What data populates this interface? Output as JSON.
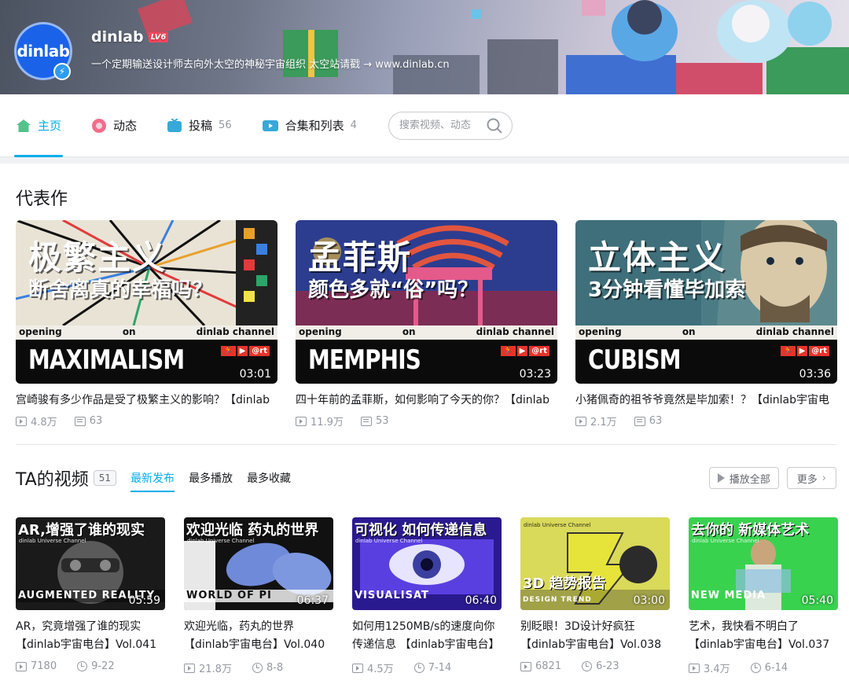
{
  "profile": {
    "avatar_text": "dinlab",
    "name": "dinlab",
    "level": "LV6",
    "signature": "一个定期输送设计师去向外太空的神秘宇宙组织 太空站请戳 → www.dinlab.cn"
  },
  "nav": {
    "tabs": [
      {
        "label": "主页",
        "count": ""
      },
      {
        "label": "动态",
        "count": ""
      },
      {
        "label": "投稿",
        "count": "56"
      },
      {
        "label": "合集和列表",
        "count": "4"
      }
    ],
    "search_placeholder": "搜索视频、动态"
  },
  "representative": {
    "title": "代表作",
    "items": [
      {
        "headline": "极繁主义",
        "subline": "断舍离真的幸福吗？",
        "strip_left": "opening",
        "strip_mid": "on",
        "strip_right": "dinlab channel",
        "word": "MAXIMALISM",
        "brand": "@rt",
        "duration": "03:01",
        "caption": "宫崎骏有多少作品是受了极繁主义的影响？【dinlab",
        "views": "4.8万",
        "danmaku": "63"
      },
      {
        "headline": "孟菲斯",
        "subline": "颜色多就“俗”吗？",
        "strip_left": "opening",
        "strip_mid": "on",
        "strip_right": "dinlab channel",
        "word": "MEMPHIS",
        "brand": "@rt",
        "duration": "03:23",
        "caption": "四十年前的孟菲斯，如何影响了今天的你？【dinlab",
        "views": "11.9万",
        "danmaku": "53"
      },
      {
        "headline": "立体主义",
        "subline": "3分钟看懂毕加索",
        "strip_left": "opening",
        "strip_mid": "on",
        "strip_right": "dinlab channel",
        "word": "CUBISM",
        "brand": "@rt",
        "duration": "03:36",
        "caption": "小猪佩奇的祖爷爷竟然是毕加索！？【dinlab宇宙电",
        "views": "2.1万",
        "danmaku": "63"
      }
    ]
  },
  "videos": {
    "title": "TA的视频",
    "count": "51",
    "tabs": [
      "最新发布",
      "最多播放",
      "最多收藏"
    ],
    "play_all": "播放全部",
    "more": "更多",
    "items": [
      {
        "thumb_title": "AR,增强了谁的现实",
        "thumb_sub": "dinlab Universe Channel",
        "band": "AUGMENTED REALITY",
        "duration": "05:59",
        "caption1": "AR，究竟增强了谁的现实",
        "caption2": "【dinlab宇宙电台】Vol.041",
        "views": "7180",
        "date": "9-22"
      },
      {
        "thumb_title": "欢迎光临 药丸的世界",
        "thumb_sub": "dinlab Universe Channel",
        "band": "WORLD OF PI",
        "duration": "06:37",
        "caption1": "欢迎光临，药丸的世界",
        "caption2": "【dinlab宇宙电台】Vol.040",
        "views": "21.8万",
        "date": "8-8"
      },
      {
        "thumb_title": "可视化 如何传递信息",
        "thumb_sub": "dinlab Universe Channel",
        "band": "VISUALISAT",
        "duration": "06:40",
        "caption1": "如何用1250MB/s的速度向你",
        "caption2": "传递信息 【dinlab宇宙电台】",
        "views": "4.5万",
        "date": "7-14"
      },
      {
        "thumb_title": "3D 趋势报告",
        "thumb_sub": "dinlab Universe Channel",
        "band": "DESIGN TREND",
        "duration": "03:00",
        "caption1": "别眨眼！3D设计好疯狂",
        "caption2": "【dinlab宇宙电台】Vol.038",
        "views": "6821",
        "date": "6-23"
      },
      {
        "thumb_title": "去你的 新媒体艺术",
        "thumb_sub": "dinlab Universe Channel",
        "band": "NEW MEDIA",
        "duration": "05:40",
        "caption1": "艺术，我快看不明白了",
        "caption2": "【dinlab宇宙电台】Vol.037",
        "views": "3.4万",
        "date": "6-14"
      }
    ]
  },
  "colors": {
    "accent": "#00aeec",
    "level_badge": "#f5475c",
    "avatar": "#1a63e8"
  }
}
